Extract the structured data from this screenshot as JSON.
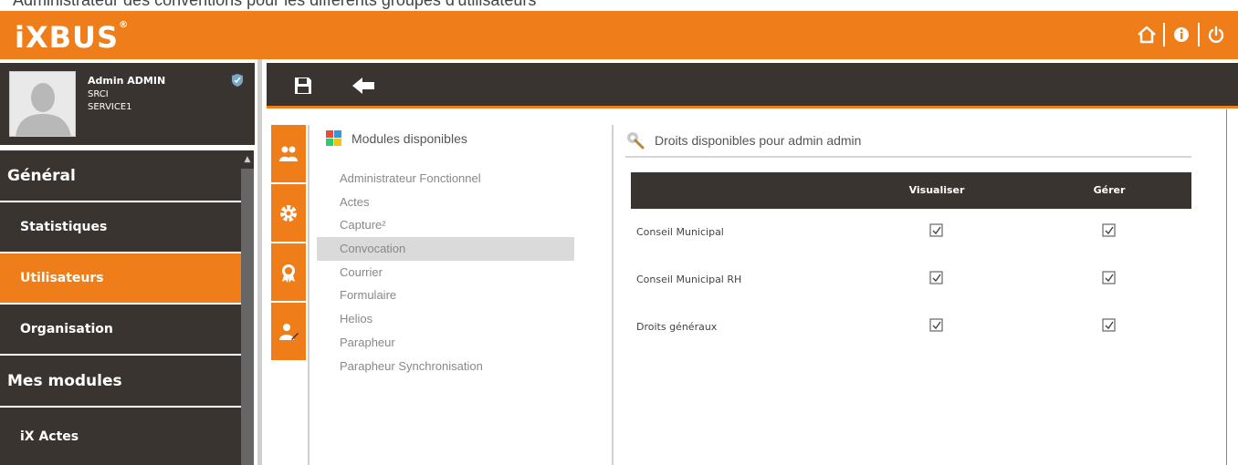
{
  "caption": "Administrateur des conventions pour les différents groupes d'utilisateurs",
  "app": {
    "logo": "iXBUS",
    "logo_mark": "®"
  },
  "topbar": {
    "icons": [
      "home-icon",
      "info-icon",
      "power-icon"
    ],
    "accent": "#ee7d1a"
  },
  "profile": {
    "name": "Admin ADMIN",
    "org": "SRCI",
    "service": "SERVICE1"
  },
  "menu": {
    "items": [
      {
        "label": "Général",
        "kind": "section",
        "active": false
      },
      {
        "label": "Statistiques",
        "kind": "sub",
        "active": false
      },
      {
        "label": "Utilisateurs",
        "kind": "sub",
        "active": true
      },
      {
        "label": "Organisation",
        "kind": "sub",
        "active": false
      },
      {
        "label": "Mes modules",
        "kind": "section",
        "active": false
      },
      {
        "label": "iX Actes",
        "kind": "sub",
        "active": false
      }
    ]
  },
  "toolbar": {
    "icons": [
      "save-icon",
      "back-arrow-icon"
    ]
  },
  "tabs": [
    "users-icon",
    "gear-icon",
    "badge-icon",
    "user-edit-icon"
  ],
  "modules": {
    "title": "Modules disponibles",
    "items": [
      {
        "label": "Administrateur Fonctionnel",
        "selected": false
      },
      {
        "label": "Actes",
        "selected": false
      },
      {
        "label": "Capture²",
        "selected": false
      },
      {
        "label": "Convocation",
        "selected": true
      },
      {
        "label": "Courrier",
        "selected": false
      },
      {
        "label": "Formulaire",
        "selected": false
      },
      {
        "label": "Helios",
        "selected": false
      },
      {
        "label": "Parapheur",
        "selected": false
      },
      {
        "label": "Parapheur Synchronisation",
        "selected": false
      }
    ]
  },
  "rights": {
    "title": "Droits disponibles pour admin admin",
    "columns": [
      "",
      "Visualiser",
      "Gérer"
    ],
    "rows": [
      {
        "label": "Conseil Municipal",
        "visualiser": true,
        "gerer": true
      },
      {
        "label": "Conseil Municipal RH",
        "visualiser": true,
        "gerer": true
      },
      {
        "label": "Droits généraux",
        "visualiser": true,
        "gerer": true
      }
    ]
  }
}
